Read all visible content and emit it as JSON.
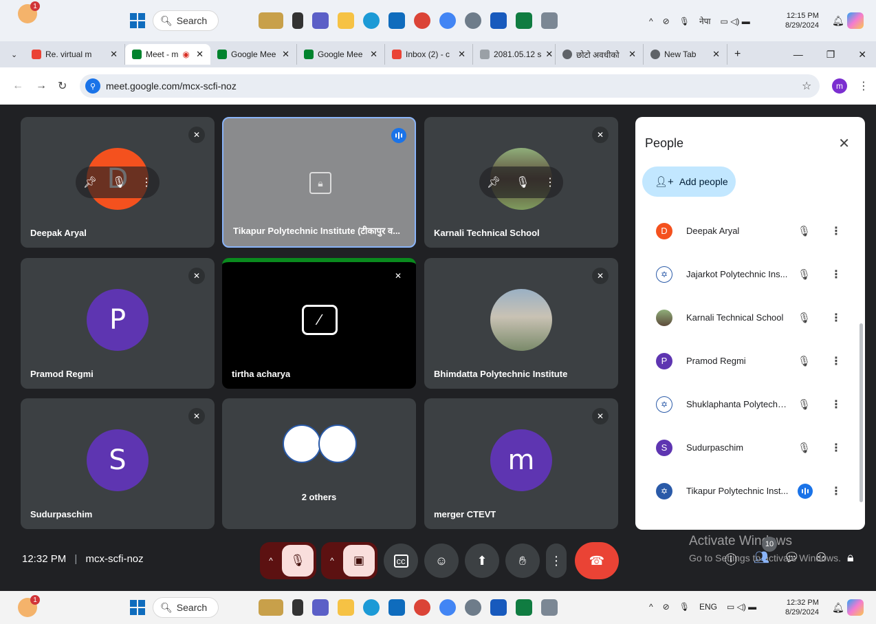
{
  "taskbar_top": {
    "notification_count": "1",
    "search_label": "Search",
    "lang": "नेपा",
    "time": "12:15 PM",
    "date": "8/29/2024"
  },
  "taskbar_bottom": {
    "notification_count": "1",
    "search_label": "Search",
    "lang": "ENG",
    "time": "12:32 PM",
    "date": "8/29/2024"
  },
  "tabs": [
    {
      "label": "Re. virtual m",
      "fav_color": "#ea4335"
    },
    {
      "label": "Meet - m",
      "fav_color": "#00832d"
    },
    {
      "label": "Google Mee",
      "fav_color": "#00832d"
    },
    {
      "label": "Google Mee",
      "fav_color": "#00832d"
    },
    {
      "label": "Inbox (2) - c",
      "fav_color": "#ea4335"
    },
    {
      "label": "2081.05.12 s",
      "fav_color": "#9aa0a6"
    },
    {
      "label": "छोटो अवधीको",
      "fav_color": "#5f6368"
    },
    {
      "label": "New Tab",
      "fav_color": "#5f6368"
    }
  ],
  "address": {
    "url": "meet.google.com/mcx-scfi-noz",
    "profile_initial": "m"
  },
  "tiles": [
    {
      "name": "Deepak Aryal",
      "initial": "D",
      "color": "#f4511e"
    },
    {
      "name": "Tikapur Polytechnic Institute (टीकापुर व..."
    },
    {
      "name": "Karnali Technical School"
    },
    {
      "name": "Pramod Regmi",
      "initial": "P",
      "color": "#5e35b1"
    },
    {
      "name": "tirtha acharya"
    },
    {
      "name": "Bhimdatta Polytechnic Institute"
    },
    {
      "name": "Sudurpaschim",
      "initial": "S",
      "color": "#5e35b1"
    },
    {
      "name": "2 others"
    },
    {
      "name": "merger CTEVT",
      "initial": "m",
      "color": "#5e35b1"
    }
  ],
  "people_panel": {
    "title": "People",
    "add_label": "Add people",
    "participants": [
      {
        "name": "Deepak Aryal",
        "initial": "D",
        "color": "#f4511e"
      },
      {
        "name": "Jajarkot Polytechnic Ins...",
        "initial": "",
        "color": "#ffffff"
      },
      {
        "name": "Karnali Technical School",
        "initial": "",
        "color": "#6d8a5a"
      },
      {
        "name": "Pramod Regmi",
        "initial": "P",
        "color": "#5e35b1"
      },
      {
        "name": "Shuklaphanta Polytechn...",
        "initial": "",
        "color": "#ffffff"
      },
      {
        "name": "Sudurpaschim",
        "initial": "S",
        "color": "#5e35b1"
      },
      {
        "name": "Tikapur Polytechnic Inst...",
        "initial": "",
        "color": "#2a5aa8"
      }
    ]
  },
  "meeting": {
    "time": "12:32 PM",
    "code": "mcx-scfi-noz",
    "participant_count": "10"
  },
  "watermark": {
    "line1": "Activate Windows",
    "line2": "Go to Settings to activate Windows."
  }
}
